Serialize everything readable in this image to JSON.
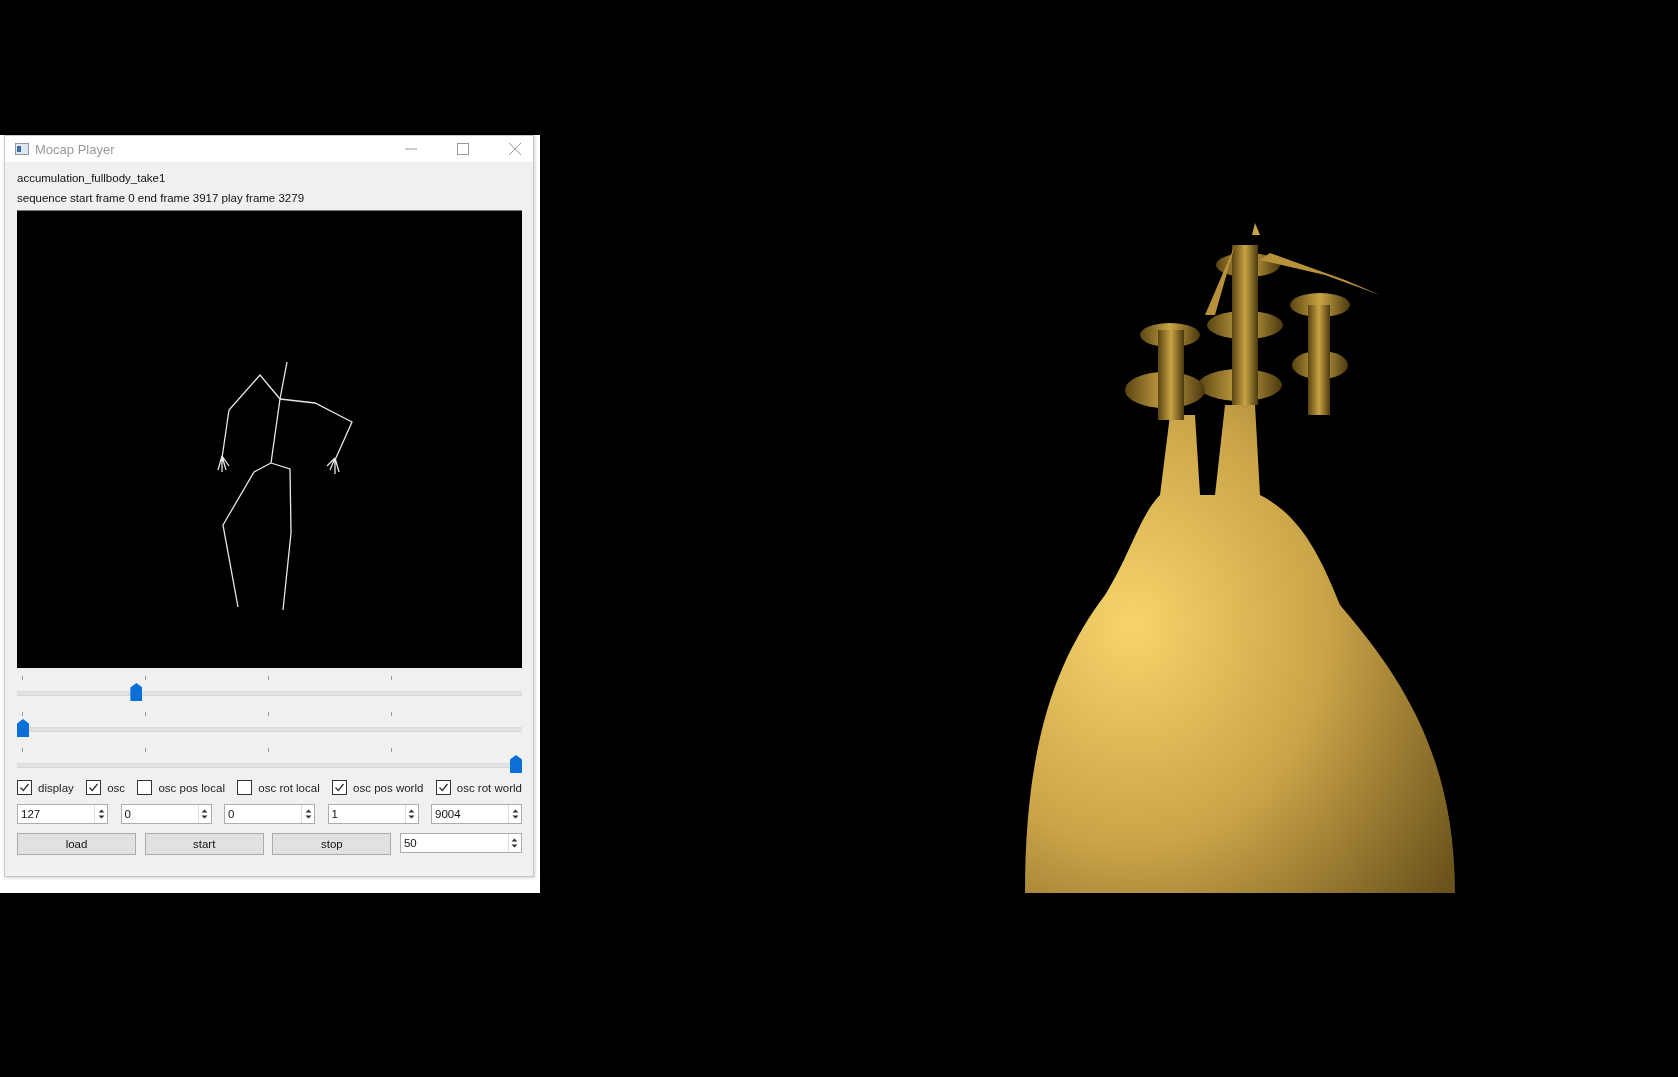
{
  "window": {
    "title": "Mocap Player"
  },
  "sequence_name": "accumulation_fullbody_take1",
  "sequence_info": "sequence start frame 0 end frame 3917 play frame 3279",
  "sliders": [
    {
      "level": 0.23
    },
    {
      "level": 0
    },
    {
      "level": 1
    }
  ],
  "checkboxes": [
    {
      "label": "display",
      "checked": true
    },
    {
      "label": "osc",
      "checked": true
    },
    {
      "label": "osc pos local",
      "checked": false
    },
    {
      "label": "osc rot local",
      "checked": false
    },
    {
      "label": "osc pos world",
      "checked": true
    },
    {
      "label": "osc rot world",
      "checked": true
    }
  ],
  "spinboxes": [
    "127",
    "0",
    "0",
    "1",
    "9004"
  ],
  "buttons": [
    "load",
    "start",
    "stop"
  ],
  "rate_spinbox": "50"
}
